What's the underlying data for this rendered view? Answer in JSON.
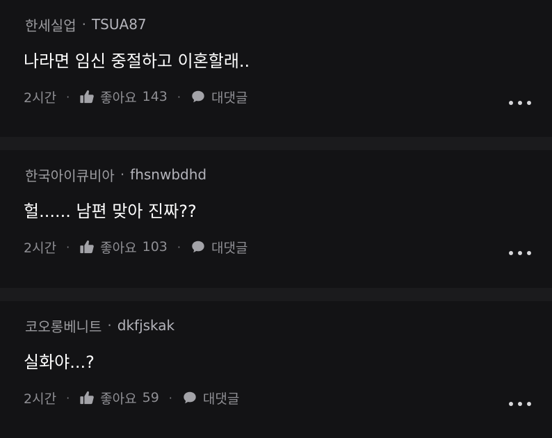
{
  "separator": "·",
  "comments": [
    {
      "company": "한세실업",
      "username": "TSUA87",
      "text": "나라면 임신 중절하고 이혼할래..",
      "time": "2시간",
      "like_label": "좋아요",
      "like_count": "143",
      "reply_label": "대댓글"
    },
    {
      "company": "한국아이큐비아",
      "username": "fhsnwbdhd",
      "text": "헐...... 남편 맞아 진짜??",
      "time": "2시간",
      "like_label": "좋아요",
      "like_count": "103",
      "reply_label": "대댓글"
    },
    {
      "company": "코오롱베니트",
      "username": "dkfjskak",
      "text": "실화야...?",
      "time": "2시간",
      "like_label": "좋아요",
      "like_count": "59",
      "reply_label": "대댓글"
    }
  ],
  "icons": {
    "like": "thumbs-up-icon",
    "reply": "speech-bubble-icon",
    "more": "more-horizontal-icon"
  },
  "colors": {
    "background": "#131315",
    "divider": "#1b1b1d",
    "meta_text": "#8f8f94",
    "body_text": "#ffffff"
  }
}
